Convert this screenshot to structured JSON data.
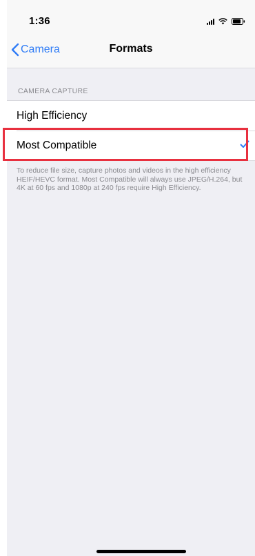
{
  "status_bar": {
    "time": "1:36",
    "icons": [
      "signal-icon",
      "wifi-icon",
      "battery-icon"
    ]
  },
  "nav": {
    "back_label": "Camera",
    "title": "Formats"
  },
  "section": {
    "header": "CAMERA CAPTURE",
    "options": [
      {
        "label": "High Efficiency",
        "selected": false
      },
      {
        "label": "Most Compatible",
        "selected": true
      }
    ],
    "footer": "To reduce file size, capture photos and videos in the high efficiency HEIF/HEVC format. Most Compatible will always use JPEG/H.264, but 4K at 60 fps and 1080p at 240 fps require High Efficiency."
  },
  "colors": {
    "accent": "#2f7cf6",
    "highlight": "#e8303f",
    "background": "#efeff4"
  }
}
